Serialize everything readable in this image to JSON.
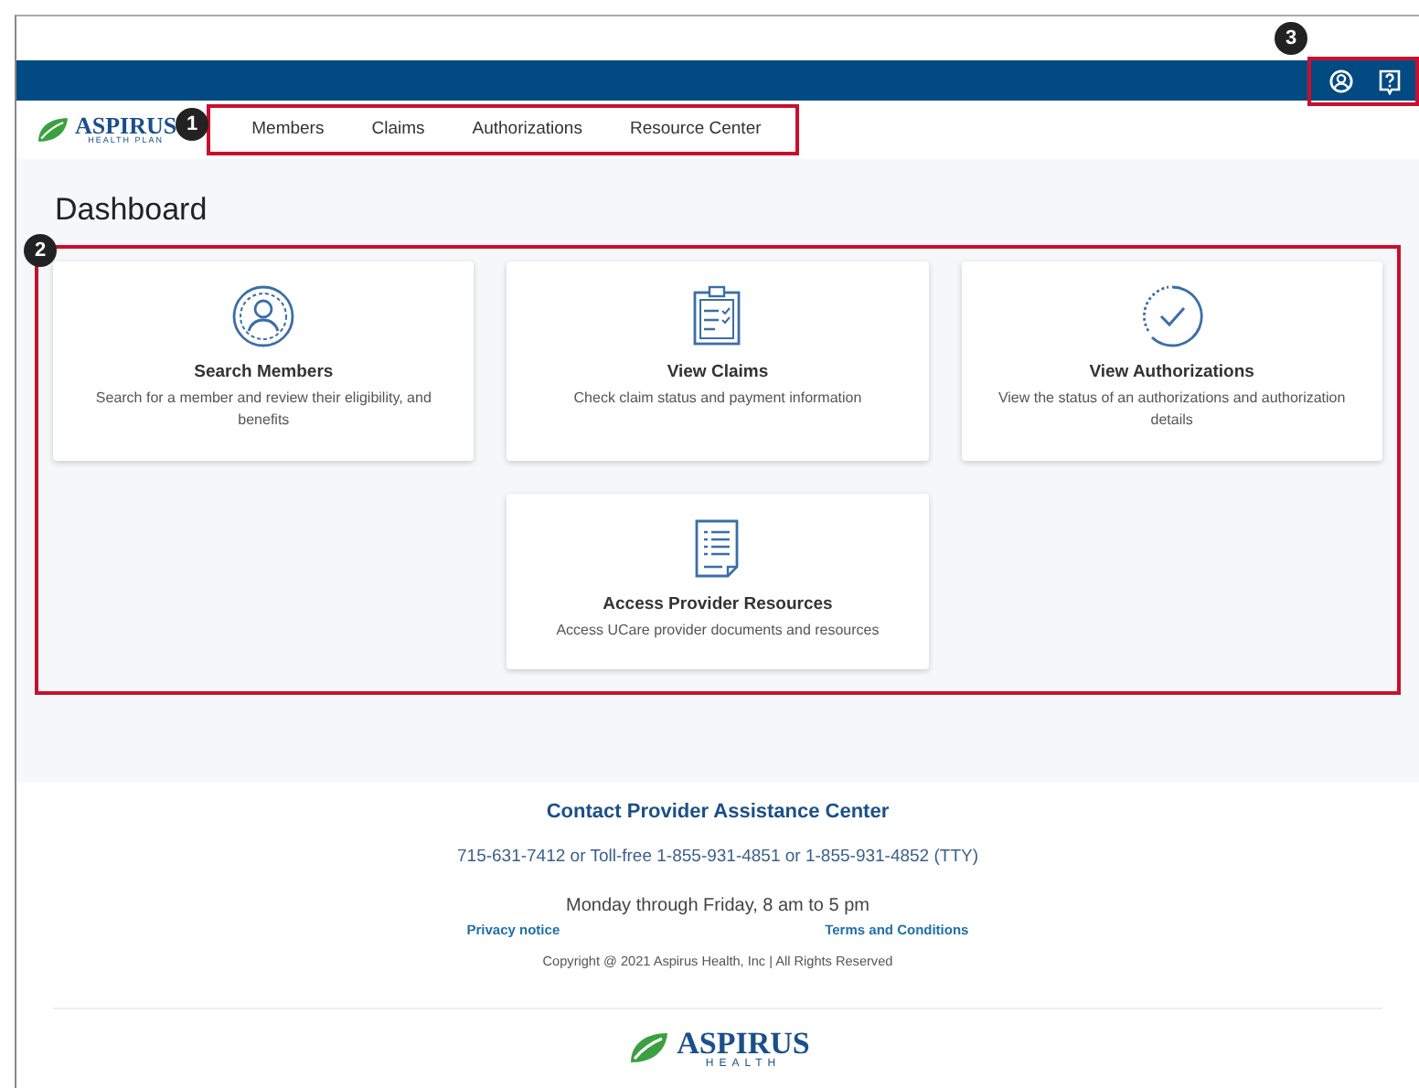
{
  "header": {
    "callout": "3"
  },
  "nav": {
    "logo": {
      "name": "ASPIRUS",
      "tagline": "HEALTH PLAN"
    },
    "callout": "1",
    "items": [
      "Members",
      "Claims",
      "Authorizations",
      "Resource Center"
    ]
  },
  "dashboard": {
    "title": "Dashboard",
    "callout": "2",
    "cards": [
      {
        "kind": "members",
        "title": "Search Members",
        "description": "Search for a member and review their eligibility, and benefits"
      },
      {
        "kind": "claims",
        "title": "View Claims",
        "description": "Check claim status and payment information"
      },
      {
        "kind": "authorizations",
        "title": "View Authorizations",
        "description": "View the status of an authorizations and authorization details"
      },
      {
        "kind": "resources",
        "title": "Access Provider Resources",
        "description": "Access UCare provider documents and resources"
      }
    ]
  },
  "footer": {
    "title": "Contact Provider Assistance Center",
    "phones": "715-631-7412 or Toll-free 1-855-931-4851 or 1-855-931-4852 (TTY)",
    "hours": "Monday through Friday, 8 am to 5 pm",
    "links": [
      "Privacy notice",
      "Terms and Conditions"
    ],
    "copyright": "Copyright @ 2021 Aspirus Health, Inc | All Rights Reserved",
    "logo": {
      "name": "ASPIRUS",
      "tagline": "HEALTH"
    }
  }
}
